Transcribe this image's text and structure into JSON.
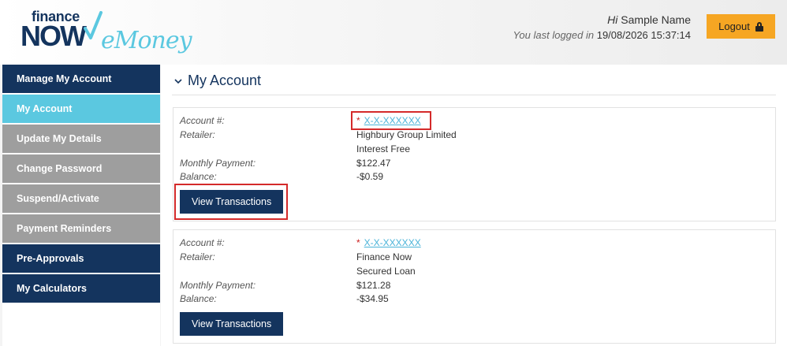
{
  "brand": {
    "finance": "finance",
    "now": "NOW",
    "emoney": "eMoney",
    "accent_color": "#5bc8e0",
    "navy_color": "#14345e"
  },
  "header": {
    "greeting_hi": "Hi",
    "user_name": "Sample Name",
    "last_login_label": "You last logged in",
    "last_login_value": "19/08/2026 15:37:14",
    "logout_label": "Logout",
    "logout_icon": "lock-icon",
    "logout_color": "#f6a623"
  },
  "sidebar": {
    "items": [
      {
        "label": "Manage My Account",
        "style": "dark"
      },
      {
        "label": "My Account",
        "style": "active"
      },
      {
        "label": "Update My Details",
        "style": "grey"
      },
      {
        "label": "Change Password",
        "style": "grey"
      },
      {
        "label": "Suspend/Activate",
        "style": "grey"
      },
      {
        "label": "Payment Reminders",
        "style": "grey"
      },
      {
        "label": "Pre-Approvals",
        "style": "dark"
      },
      {
        "label": "My Calculators",
        "style": "dark"
      }
    ]
  },
  "main": {
    "section_title": "My Account",
    "labels": {
      "account": "Account #:",
      "retailer": "Retailer:",
      "monthly_payment": "Monthly Payment:",
      "balance": "Balance:"
    },
    "accounts": [
      {
        "star": "*",
        "account_number": "X-X-XXXXXX",
        "retailer": "Highbury Group Limited",
        "product": "Interest Free",
        "monthly_payment": "$122.47",
        "balance": "-$0.59",
        "button_label": "View Transactions"
      },
      {
        "star": "*",
        "account_number": "X-X-XXXXXX",
        "retailer": "Finance Now",
        "product": "Secured Loan",
        "monthly_payment": "$121.28",
        "balance": "-$34.95",
        "button_label": "View Transactions"
      }
    ]
  }
}
